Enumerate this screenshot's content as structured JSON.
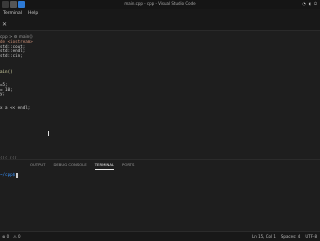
{
  "window": {
    "title": "main.cpp - cpp - Visual Studio Code"
  },
  "menu": [
    "Terminal",
    "Help"
  ],
  "breadcrumb": "cpp > ⚙ main()",
  "editor_lines": [
    {
      "text": "de <iostream>",
      "cls": "inc"
    },
    {
      "text": "std::cout;",
      "cls": ""
    },
    {
      "text": "std::endl;",
      "cls": ""
    },
    {
      "text": "std::cin;",
      "cls": ""
    },
    {
      "text": "",
      "cls": ""
    },
    {
      "text": "ain()",
      "cls": "fn"
    },
    {
      "text": "",
      "cls": ""
    },
    {
      "text": "=5;",
      "cls": ""
    },
    {
      "text": "= 10;",
      "cls": ""
    },
    {
      "text": "y;",
      "cls": ""
    },
    {
      "text": "",
      "cls": ""
    },
    {
      "text": "x a << endl;",
      "cls": ""
    }
  ],
  "panel": {
    "collapsed_label": "⟨⟨⟨  ⟨⟨⟨",
    "tabs": [
      "OUTPUT",
      "DEBUG CONSOLE",
      "TERMINAL",
      "PORTS"
    ],
    "active_tab": "TERMINAL",
    "terminal_prompt": "~/cpp$"
  },
  "status": {
    "left": [
      "⊗ 0",
      "⚠ 0"
    ],
    "right": [
      "Ln 15, Col 1",
      "Spaces: 4",
      "UTF-8"
    ]
  },
  "colors": {
    "accent": "#0078d4",
    "background": "#1e1e1e"
  }
}
